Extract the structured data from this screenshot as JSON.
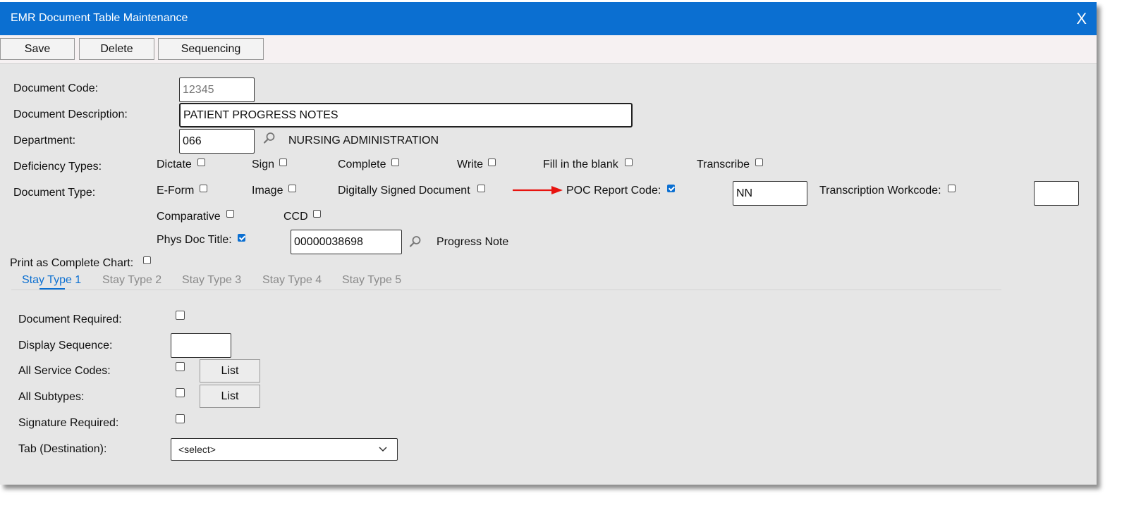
{
  "window": {
    "title": "EMR Document Table Maintenance",
    "close_label": "X"
  },
  "toolbar": {
    "save": "Save",
    "delete": "Delete",
    "sequencing": "Sequencing"
  },
  "form": {
    "document_code_label": "Document Code:",
    "document_code_value": "12345",
    "document_description_label": "Document Description:",
    "document_description_value": "PATIENT PROGRESS NOTES",
    "department_label": "Department:",
    "department_value": "066",
    "department_name": "NURSING ADMINISTRATION",
    "deficiency_types_label": "Deficiency Types:",
    "deficiency_types": [
      {
        "label": "Dictate",
        "checked": false
      },
      {
        "label": "Sign",
        "checked": false
      },
      {
        "label": "Complete",
        "checked": false
      },
      {
        "label": "Write",
        "checked": false
      },
      {
        "label": "Fill in the blank",
        "checked": false
      },
      {
        "label": "Transcribe",
        "checked": false
      }
    ],
    "document_type_label": "Document Type:",
    "document_types": [
      {
        "label": "E-Form",
        "checked": false
      },
      {
        "label": "Image",
        "checked": false
      },
      {
        "label": "Digitally Signed Document",
        "checked": false
      },
      {
        "label": "POC Report Code:",
        "checked": true
      },
      {
        "label": "Transcription Workcode:",
        "checked": false
      },
      {
        "label": "Comparative",
        "checked": false
      },
      {
        "label": "CCD",
        "checked": false
      }
    ],
    "poc_report_code_value": "NN",
    "transcription_workcode_value": "",
    "phys_doc_title_label": "Phys Doc Title:",
    "phys_doc_title_checked": true,
    "phys_doc_title_value": "00000038698",
    "phys_doc_title_name": "Progress Note",
    "print_complete_chart_label": "Print as Complete Chart:",
    "print_complete_chart_checked": false
  },
  "tabs": [
    {
      "label": "Stay Type 1",
      "active": true
    },
    {
      "label": "Stay Type 2",
      "active": false
    },
    {
      "label": "Stay Type 3",
      "active": false
    },
    {
      "label": "Stay Type 4",
      "active": false
    },
    {
      "label": "Stay Type 5",
      "active": false
    }
  ],
  "stay": {
    "document_required_label": "Document Required:",
    "display_sequence_label": "Display Sequence:",
    "display_sequence_value": "",
    "all_service_codes_label": "All Service Codes:",
    "all_subtypes_label": "All Subtypes:",
    "list_label": "List",
    "signature_required_label": "Signature Required:",
    "tab_destination_label": "Tab (Destination):",
    "tab_destination_value": "<select>"
  },
  "colors": {
    "titlebar": "#0b6fd1",
    "accent": "#0b6fd1",
    "annotation_arrow": "#e8130f"
  }
}
